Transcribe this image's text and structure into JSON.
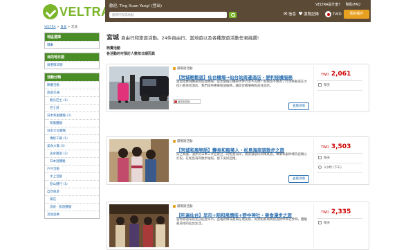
{
  "header": {
    "logo": "VELTRA",
    "greeting": "歡迎, Ting Xuan Yang! (登出)",
    "search_placeholder": "搜尋行程或地點",
    "top_links": [
      "VELTRA是什麼?",
      "幫助/FAQ"
    ],
    "messages_label": "信息",
    "wishlist_label": "瀏覽記錄",
    "currency_label": "TWD",
    "mypage_label": "我的帳戶",
    "colors": {
      "brand_green": "#7ab52a",
      "header_brown": "#5b4a35",
      "accent_orange": "#e8a020"
    }
  },
  "breadcrumb": {
    "items": [
      "VELTRA",
      "日本",
      "宮城"
    ],
    "separator": " > "
  },
  "sidebar": {
    "area": {
      "title": "地區選擇",
      "items": [
        "日本"
      ]
    },
    "date": {
      "title": "目的地日期",
      "items": [
        "請選擇日期"
      ]
    },
    "category": {
      "title": "活動分類",
      "items": [
        {
          "label": "節慶活動",
          "type": "link"
        },
        {
          "label": "旅遊交通",
          "type": "link"
        },
        {
          "label": "觀光巴士 (1)",
          "type": "sub"
        },
        {
          "label": "巴士遊",
          "type": "sub"
        },
        {
          "label": "日本和服體驗 (3)",
          "type": "link"
        },
        {
          "label": "和服體驗",
          "type": "sub"
        },
        {
          "label": "日本文化體驗",
          "type": "link"
        },
        {
          "label": "傳統工藝 (1)",
          "type": "sub"
        },
        {
          "label": "美食大賞 (3)",
          "type": "link"
        },
        {
          "label": "美食團遊 (2)",
          "type": "sub"
        },
        {
          "label": "日本酒體驗",
          "type": "sub"
        },
        {
          "label": "戶外活動",
          "type": "link"
        },
        {
          "label": "水上活動",
          "type": "sub"
        },
        {
          "label": "登山健行 (1)",
          "type": "sub"
        },
        {
          "label": "自然風景",
          "type": "link"
        },
        {
          "label": "賞花",
          "type": "sub"
        },
        {
          "label": "溫泉 · 旅遊體驗",
          "type": "sub"
        },
        {
          "label": "其他遊樂",
          "type": "link"
        }
      ]
    }
  },
  "main": {
    "title": "宮城",
    "title_sub": "自由行和旅遊活動。24件自由行、當地遊以及各種旅遊活動任君挑選!",
    "subtitle_1": "熱賣活動",
    "subtitle_2": "各活動的可預訂人數依日期而異",
    "cards": [
      {
        "badge": "最暢銷活動",
        "title": "【宮城輕鬆遊】仙台機場→仙台站周邊酒店・便利接機服務",
        "desc": "當您搭乘飛機來到仙台機場，是否會擔心攜帶大件行李不方便？如果您不想為了行李移動或在大街小巷尋找酒店，我們提供專車接送服務，讓您從機場輕鬆前往酒店。",
        "more": "查看詳情",
        "mini": "最優惠價格",
        "price_currency": "TWD",
        "price": "2,061",
        "row1": "每天",
        "row2": "",
        "button": "查看詳情"
      },
      {
        "badge": "最暢銷活動",
        "title": "【宮城和風物語】變身和服美人・松島海岸遊散步之旅",
        "desc": "穿上和服，漫步於日本三大名景之一的松島海岸，感受濃郁的和風氣息。專業和服師傅為您精心打扮，在松島海岸散步拍照，留下美好回憶。",
        "more": "查看詳情",
        "mini": "",
        "price_currency": "TWD",
        "price": "3,503",
        "row1": "每天",
        "row2": "3小時 (下午)",
        "button": "查看詳情"
      },
      {
        "badge": "最暢銷活動",
        "title": "【吃遍仙台】早市+昭和風情街+野中神社・美食漫步之旅",
        "desc": "當地導遊帶您走訪仙台早市，品嚐新鮮海產與在地美食，再到昭和風情街及野中神社參拜，體驗最道地的仙台生活。",
        "more": "",
        "mini": "",
        "price_currency": "TWD",
        "price": "2,335",
        "row1": "每天",
        "row2": "",
        "button": ""
      }
    ]
  }
}
